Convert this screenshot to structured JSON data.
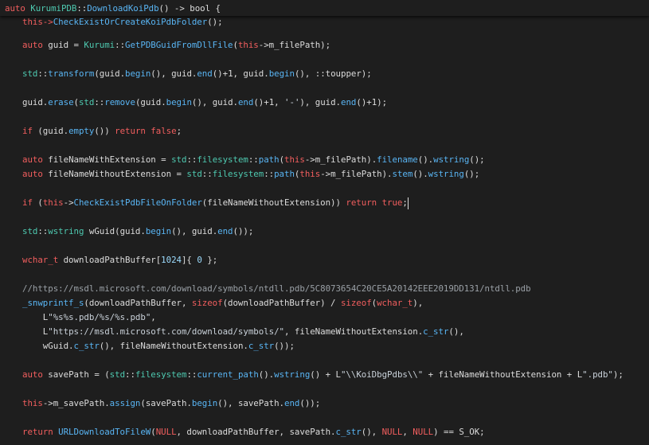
{
  "colors": {
    "background": "#1e1e1e",
    "default": "#dcdcdc",
    "keyword": "#f25e5e",
    "type": "#4ec9b0",
    "function": "#59b5f4",
    "string": "#c9d1d9",
    "comment": "#9aa0a6",
    "number": "#9cdcfe"
  },
  "sticky_header": [
    {
      "t": "auto ",
      "c": "keyword"
    },
    {
      "t": "KurumiPDB",
      "c": "type"
    },
    {
      "t": "::",
      "c": "default"
    },
    {
      "t": "DownloadKoiPdb",
      "c": "function"
    },
    {
      "t": "() -> bool {",
      "c": "default"
    }
  ],
  "partial_line": [
    {
      "t": "this->",
      "c": "keyword"
    },
    {
      "t": "CheckExistOrCreateKoiPdbFolder",
      "c": "function"
    },
    {
      "t": "();",
      "c": "default"
    }
  ],
  "code_lines": [
    [
      {
        "t": "auto",
        "c": "keyword"
      },
      {
        "t": " guid = ",
        "c": "default"
      },
      {
        "t": "Kurumi",
        "c": "type"
      },
      {
        "t": "::",
        "c": "default"
      },
      {
        "t": "GetPDBGuidFromDllFile",
        "c": "function"
      },
      {
        "t": "(",
        "c": "default"
      },
      {
        "t": "this",
        "c": "keyword"
      },
      {
        "t": "->m_filePath);",
        "c": "default"
      }
    ],
    [],
    [
      {
        "t": "std",
        "c": "type"
      },
      {
        "t": "::",
        "c": "default"
      },
      {
        "t": "transform",
        "c": "function"
      },
      {
        "t": "(guid.",
        "c": "default"
      },
      {
        "t": "begin",
        "c": "function"
      },
      {
        "t": "(), guid.",
        "c": "default"
      },
      {
        "t": "end",
        "c": "function"
      },
      {
        "t": "()+1, guid.",
        "c": "default"
      },
      {
        "t": "begin",
        "c": "function"
      },
      {
        "t": "(), ::toupper);",
        "c": "default"
      }
    ],
    [],
    [
      {
        "t": "guid.",
        "c": "default"
      },
      {
        "t": "erase",
        "c": "function"
      },
      {
        "t": "(",
        "c": "default"
      },
      {
        "t": "std",
        "c": "type"
      },
      {
        "t": "::",
        "c": "default"
      },
      {
        "t": "remove",
        "c": "function"
      },
      {
        "t": "(guid.",
        "c": "default"
      },
      {
        "t": "begin",
        "c": "function"
      },
      {
        "t": "(), guid.",
        "c": "default"
      },
      {
        "t": "end",
        "c": "function"
      },
      {
        "t": "()+1, ",
        "c": "default"
      },
      {
        "t": "'-'",
        "c": "string"
      },
      {
        "t": "), guid.",
        "c": "default"
      },
      {
        "t": "end",
        "c": "function"
      },
      {
        "t": "()+1);",
        "c": "default"
      }
    ],
    [],
    [
      {
        "t": "if",
        "c": "keyword"
      },
      {
        "t": " (guid.",
        "c": "default"
      },
      {
        "t": "empty",
        "c": "function"
      },
      {
        "t": "()) ",
        "c": "default"
      },
      {
        "t": "return",
        "c": "keyword"
      },
      {
        "t": " ",
        "c": "default"
      },
      {
        "t": "false",
        "c": "keyword"
      },
      {
        "t": ";",
        "c": "default"
      }
    ],
    [],
    [
      {
        "t": "auto",
        "c": "keyword"
      },
      {
        "t": " fileNameWithExtension = ",
        "c": "default"
      },
      {
        "t": "std",
        "c": "type"
      },
      {
        "t": "::",
        "c": "default"
      },
      {
        "t": "filesystem",
        "c": "type"
      },
      {
        "t": "::",
        "c": "default"
      },
      {
        "t": "path",
        "c": "function"
      },
      {
        "t": "(",
        "c": "default"
      },
      {
        "t": "this",
        "c": "keyword"
      },
      {
        "t": "->m_filePath).",
        "c": "default"
      },
      {
        "t": "filename",
        "c": "function"
      },
      {
        "t": "().",
        "c": "default"
      },
      {
        "t": "wstring",
        "c": "function"
      },
      {
        "t": "();",
        "c": "default"
      }
    ],
    [
      {
        "t": "auto",
        "c": "keyword"
      },
      {
        "t": " fileNameWithoutExtension = ",
        "c": "default"
      },
      {
        "t": "std",
        "c": "type"
      },
      {
        "t": "::",
        "c": "default"
      },
      {
        "t": "filesystem",
        "c": "type"
      },
      {
        "t": "::",
        "c": "default"
      },
      {
        "t": "path",
        "c": "function"
      },
      {
        "t": "(",
        "c": "default"
      },
      {
        "t": "this",
        "c": "keyword"
      },
      {
        "t": "->m_filePath).",
        "c": "default"
      },
      {
        "t": "stem",
        "c": "function"
      },
      {
        "t": "().",
        "c": "default"
      },
      {
        "t": "wstring",
        "c": "function"
      },
      {
        "t": "();",
        "c": "default"
      }
    ],
    [],
    [
      {
        "t": "if",
        "c": "keyword"
      },
      {
        "t": " (",
        "c": "default"
      },
      {
        "t": "this",
        "c": "keyword"
      },
      {
        "t": "->",
        "c": "default"
      },
      {
        "t": "CheckExistPdbFileOnFolder",
        "c": "function"
      },
      {
        "t": "(fileNameWithoutExtension)) ",
        "c": "default"
      },
      {
        "t": "return",
        "c": "keyword"
      },
      {
        "t": " ",
        "c": "default"
      },
      {
        "t": "true",
        "c": "keyword"
      },
      {
        "t": ";",
        "c": "default"
      }
    ],
    [],
    [
      {
        "t": "std",
        "c": "type"
      },
      {
        "t": "::",
        "c": "default"
      },
      {
        "t": "wstring",
        "c": "type"
      },
      {
        "t": " wGuid(guid.",
        "c": "default"
      },
      {
        "t": "begin",
        "c": "function"
      },
      {
        "t": "(), guid.",
        "c": "default"
      },
      {
        "t": "end",
        "c": "function"
      },
      {
        "t": "());",
        "c": "default"
      }
    ],
    [],
    [
      {
        "t": "wchar_t",
        "c": "keyword"
      },
      {
        "t": " downloadPathBuffer[",
        "c": "default"
      },
      {
        "t": "1024",
        "c": "number"
      },
      {
        "t": "]{ ",
        "c": "default"
      },
      {
        "t": "0",
        "c": "number"
      },
      {
        "t": " };",
        "c": "default"
      }
    ],
    [],
    [
      {
        "t": "//https://msdl.microsoft.com/download/symbols/ntdll.pdb/5C8073654C20CE5A20142EEE2019DD131/ntdll.pdb",
        "c": "comment"
      }
    ],
    [
      {
        "t": "_snwprintf_s",
        "c": "function"
      },
      {
        "t": "(downloadPathBuffer, ",
        "c": "default"
      },
      {
        "t": "sizeof",
        "c": "keyword"
      },
      {
        "t": "(downloadPathBuffer) / ",
        "c": "default"
      },
      {
        "t": "sizeof",
        "c": "keyword"
      },
      {
        "t": "(",
        "c": "default"
      },
      {
        "t": "wchar_t",
        "c": "keyword"
      },
      {
        "t": "),",
        "c": "default"
      }
    ],
    [
      {
        "t": "    L",
        "c": "default"
      },
      {
        "t": "\"%s%s.pdb/%s/%s.pdb\"",
        "c": "string"
      },
      {
        "t": ",",
        "c": "default"
      }
    ],
    [
      {
        "t": "    L",
        "c": "default"
      },
      {
        "t": "\"https://msdl.microsoft.com/download/symbols/\"",
        "c": "string"
      },
      {
        "t": ", fileNameWithoutExtension.",
        "c": "default"
      },
      {
        "t": "c_str",
        "c": "function"
      },
      {
        "t": "(),",
        "c": "default"
      }
    ],
    [
      {
        "t": "    wGuid.",
        "c": "default"
      },
      {
        "t": "c_str",
        "c": "function"
      },
      {
        "t": "(), fileNameWithoutExtension.",
        "c": "default"
      },
      {
        "t": "c_str",
        "c": "function"
      },
      {
        "t": "());",
        "c": "default"
      }
    ],
    [],
    [
      {
        "t": "auto",
        "c": "keyword"
      },
      {
        "t": " savePath = (",
        "c": "default"
      },
      {
        "t": "std",
        "c": "type"
      },
      {
        "t": "::",
        "c": "default"
      },
      {
        "t": "filesystem",
        "c": "type"
      },
      {
        "t": "::",
        "c": "default"
      },
      {
        "t": "current_path",
        "c": "function"
      },
      {
        "t": "().",
        "c": "default"
      },
      {
        "t": "wstring",
        "c": "function"
      },
      {
        "t": "() + L",
        "c": "default"
      },
      {
        "t": "\"\\\\KoiDbgPdbs\\\\\"",
        "c": "string"
      },
      {
        "t": " + fileNameWithoutExtension + L",
        "c": "default"
      },
      {
        "t": "\".pdb\"",
        "c": "string"
      },
      {
        "t": ");",
        "c": "default"
      }
    ],
    [],
    [
      {
        "t": "this",
        "c": "keyword"
      },
      {
        "t": "->m_savePath.",
        "c": "default"
      },
      {
        "t": "assign",
        "c": "function"
      },
      {
        "t": "(savePath.",
        "c": "default"
      },
      {
        "t": "begin",
        "c": "function"
      },
      {
        "t": "(), savePath.",
        "c": "default"
      },
      {
        "t": "end",
        "c": "function"
      },
      {
        "t": "());",
        "c": "default"
      }
    ],
    [],
    [
      {
        "t": "return",
        "c": "keyword"
      },
      {
        "t": " ",
        "c": "default"
      },
      {
        "t": "URLDownloadToFileW",
        "c": "function"
      },
      {
        "t": "(",
        "c": "default"
      },
      {
        "t": "NULL",
        "c": "keyword"
      },
      {
        "t": ", downloadPathBuffer, savePath.",
        "c": "default"
      },
      {
        "t": "c_str",
        "c": "function"
      },
      {
        "t": "(), ",
        "c": "default"
      },
      {
        "t": "NULL",
        "c": "keyword"
      },
      {
        "t": ", ",
        "c": "default"
      },
      {
        "t": "NULL",
        "c": "keyword"
      },
      {
        "t": ") == S_OK;",
        "c": "default"
      }
    ]
  ]
}
